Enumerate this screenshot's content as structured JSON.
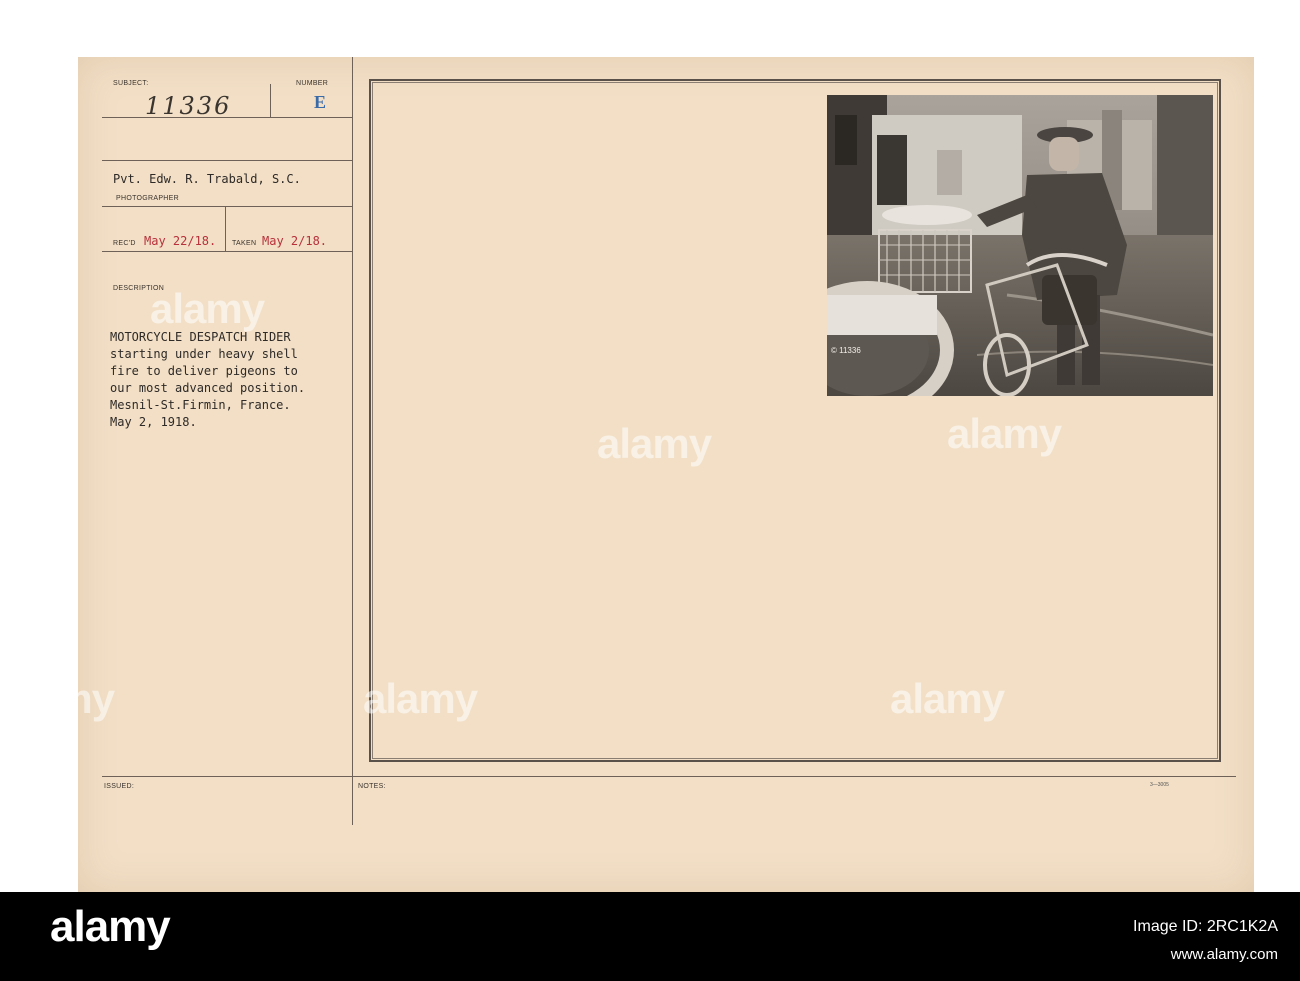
{
  "card": {
    "subject_label": "SUBJECT:",
    "subject_number": "11336",
    "number_label": "NUMBER",
    "number_stamp": "E",
    "photographer_name": "Pvt. Edw. R. Trabald, S.C.",
    "photographer_label": "PHOTOGRAPHER",
    "recd_label": "REC'D",
    "recd_date": "May 22/18.",
    "taken_label": "TAKEN",
    "taken_date": "May 2/18.",
    "description_label": "DESCRIPTION",
    "description_lines": [
      "MOTORCYCLE DESPATCH RIDER",
      "starting under heavy shell",
      "fire to deliver pigeons to",
      "our most advanced position.",
      "Mesnil-St.Firmin, France.",
      "May 2, 1918."
    ],
    "issued_label": "ISSUED:",
    "notes_label": "NOTES:",
    "form_code": "3—3005"
  },
  "photo": {
    "negative_number": "© 11336"
  },
  "watermarks": [
    "alamy",
    "alamy",
    "alamy",
    "alamy",
    "alamy",
    "alamy"
  ],
  "footer": {
    "logo": "alamy",
    "image_id": "Image ID: 2RC1K2A",
    "url": "www.alamy.com"
  }
}
